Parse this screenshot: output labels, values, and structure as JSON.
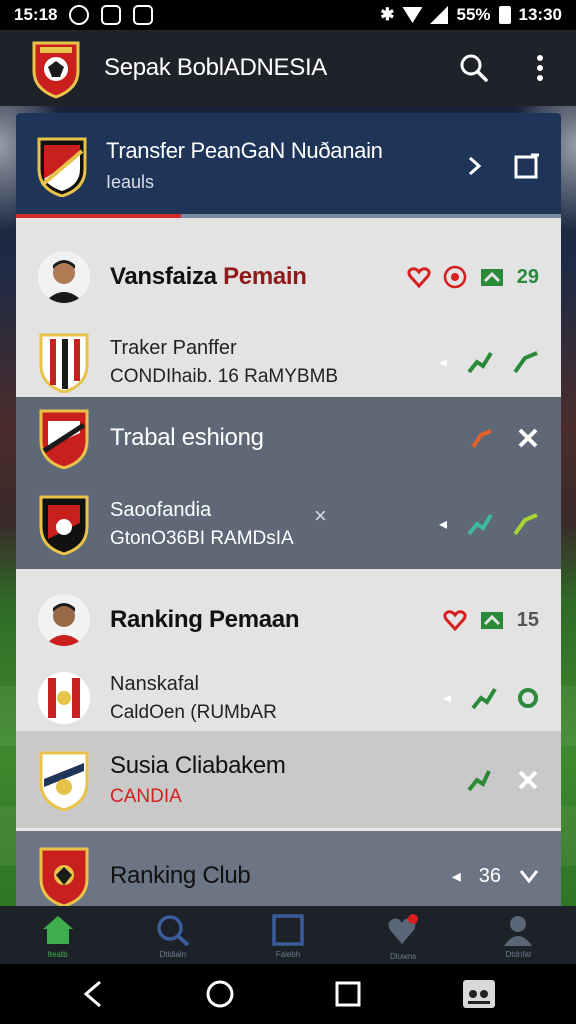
{
  "status_bar": {
    "time": "15:18",
    "battery": "55%",
    "clock_right": "13:30"
  },
  "app_bar": {
    "title": "Sepak BoblADNESIA"
  },
  "header": {
    "title": "Transfer PeanGaN Nuðanain",
    "subtitle": "Ieauls"
  },
  "section1": {
    "title_prefix": "Vansfaiza ",
    "title_red": "Pemain",
    "count": "29",
    "sub_line1": "Traker Panffer",
    "sub_line2": "CONDIhaib. 16 RaMYBMB"
  },
  "section2": {
    "title": "Trabal eshiong",
    "sub_line1": "Saoofandia",
    "sub_line2": "GtonO36BI RAMDsIA"
  },
  "section3": {
    "title": "Ranking Pemaan",
    "count": "15",
    "sub_line1": "Nanskafal",
    "sub_line2": "CaldOen (RUMbAR"
  },
  "section4": {
    "title": "Susia Cliabakem",
    "subtitle": "CANDIA"
  },
  "section5": {
    "title": "Ranking Club",
    "count": "36"
  },
  "bottom_nav": {
    "items": [
      {
        "label": "Iteatb",
        "icon": "home-icon"
      },
      {
        "label": "Dtldialn",
        "icon": "search-icon"
      },
      {
        "label": "Falebh",
        "icon": "square-icon"
      },
      {
        "label": "Dluwns",
        "icon": "heart-icon"
      },
      {
        "label": "Dtdnfat",
        "icon": "profile-icon"
      }
    ]
  },
  "colors": {
    "accent_green": "#3fae4f",
    "accent_red": "#d02a2a",
    "header_blue": "#1e3558"
  }
}
